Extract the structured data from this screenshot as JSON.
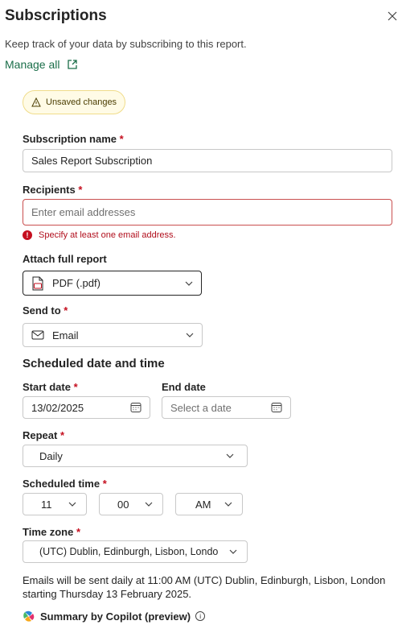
{
  "panel": {
    "title": "Subscriptions",
    "description": "Keep track of your data by subscribing to this report.",
    "manage_all": "Manage all",
    "unsaved_badge": "Unsaved changes"
  },
  "form": {
    "subscription_name": {
      "label": "Subscription name",
      "required": "*",
      "value": "Sales Report Subscription"
    },
    "recipients": {
      "label": "Recipients",
      "required": "*",
      "placeholder": "Enter email addresses",
      "error": "Specify at least one email address."
    },
    "attach": {
      "label": "Attach full report",
      "value": "PDF (.pdf)"
    },
    "send_to": {
      "label": "Send to",
      "required": "*",
      "value": "Email"
    },
    "schedule_heading": "Scheduled date and time",
    "start_date": {
      "label": "Start date",
      "required": "*",
      "value": "13/02/2025"
    },
    "end_date": {
      "label": "End date",
      "placeholder": "Select a date"
    },
    "repeat": {
      "label": "Repeat",
      "required": "*",
      "value": "Daily"
    },
    "scheduled_time": {
      "label": "Scheduled time",
      "required": "*",
      "hour": "11",
      "minute": "00",
      "ampm": "AM"
    },
    "time_zone": {
      "label": "Time zone",
      "required": "*",
      "value": "(UTC) Dublin, Edinburgh, Lisbon, Londo"
    },
    "note": "Emails will be sent daily at 11:00 AM (UTC) Dublin, Edinburgh, Lisbon, London starting Thursday 13 February 2025.",
    "copilot": "Summary by Copilot (preview)"
  },
  "colors": {
    "accent_link": "#1a6e49",
    "error": "#c50f1f",
    "warning_bg": "#fffbe6"
  }
}
